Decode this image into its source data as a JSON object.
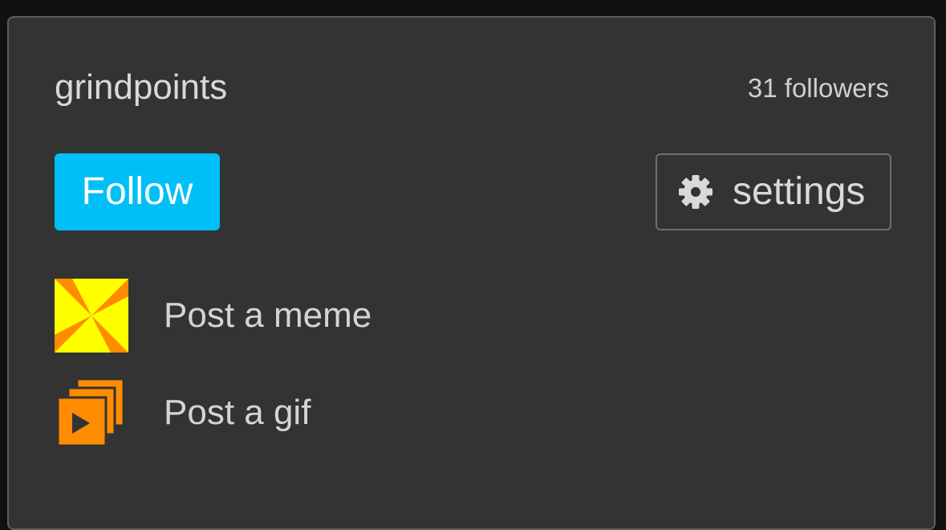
{
  "profile": {
    "username": "grindpoints",
    "followers_label": "31 followers"
  },
  "actions": {
    "follow_label": "Follow",
    "settings_label": "settings",
    "settings_icon": "gear-icon",
    "post_meme_label": "Post a meme",
    "post_meme_icon": "meme-pinwheel-icon",
    "post_gif_label": "Post a gif",
    "post_gif_icon": "gif-stack-play-icon"
  },
  "colors": {
    "follow_button": "#00bff6",
    "panel_background": "#333333",
    "meme_icon_orange": "#ff8c00",
    "meme_icon_yellow": "#ffff00",
    "gif_icon_orange": "#ff8c00"
  }
}
